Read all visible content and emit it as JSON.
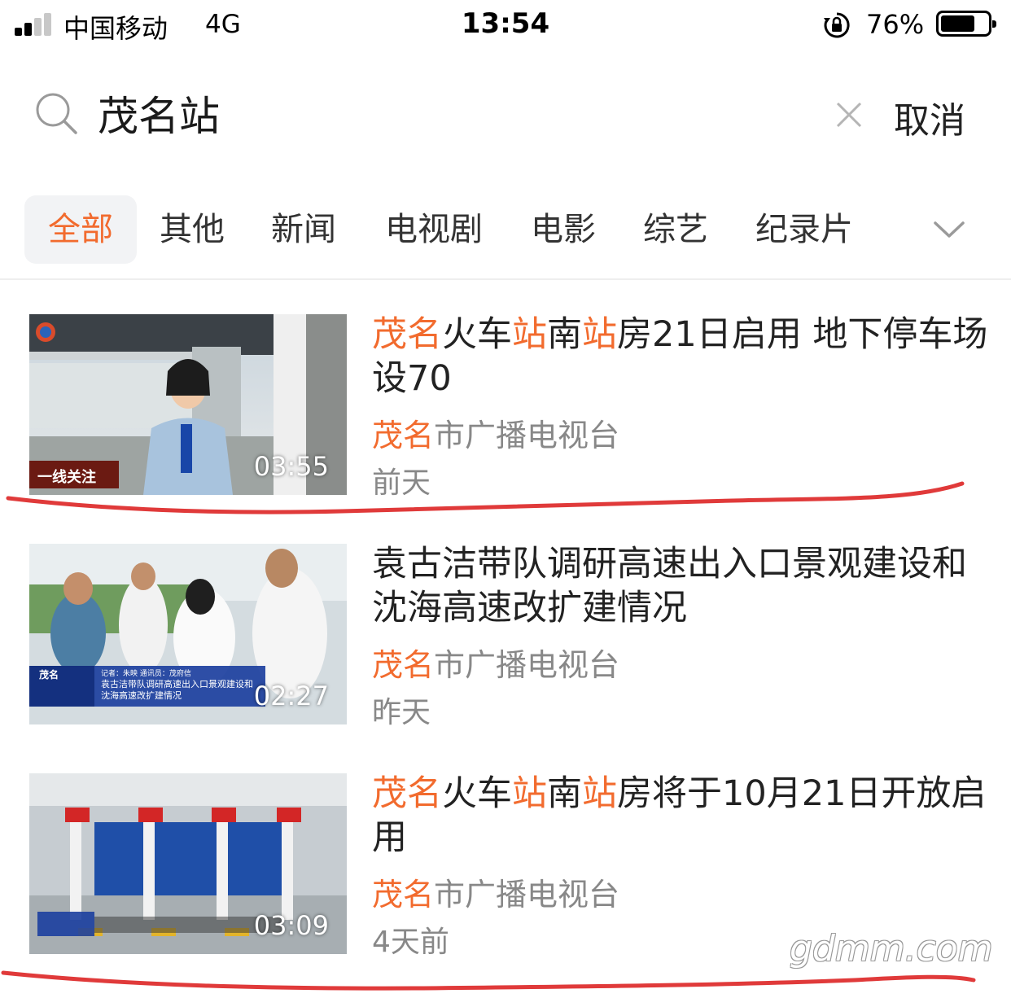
{
  "status_bar": {
    "carrier": "中国移动",
    "network": "4G",
    "time": "13:54",
    "battery_percent": "76%",
    "battery_level": 0.76
  },
  "search": {
    "query": "茂名站",
    "cancel_label": "取消"
  },
  "tabs": [
    {
      "label": "全部",
      "active": true
    },
    {
      "label": "其他",
      "active": false
    },
    {
      "label": "新闻",
      "active": false
    },
    {
      "label": "电视剧",
      "active": false
    },
    {
      "label": "电影",
      "active": false
    },
    {
      "label": "综艺",
      "active": false
    },
    {
      "label": "纪录片",
      "active": false
    }
  ],
  "highlight_color": "#f26b2e",
  "results": [
    {
      "title_segments": [
        {
          "text": "茂名",
          "hl": true
        },
        {
          "text": "火车",
          "hl": false
        },
        {
          "text": "站",
          "hl": true
        },
        {
          "text": "南",
          "hl": false
        },
        {
          "text": "站",
          "hl": true
        },
        {
          "text": "房21日启用 地下停车场设70",
          "hl": false
        }
      ],
      "source_segments": [
        {
          "text": "茂名",
          "hl": true
        },
        {
          "text": "市广播电视台",
          "hl": false
        }
      ],
      "date": "前天",
      "duration": "03:55"
    },
    {
      "title_segments": [
        {
          "text": "袁古洁带队调研高速出入口景观建设和沈海高速改扩建情况",
          "hl": false
        }
      ],
      "source_segments": [
        {
          "text": "茂名",
          "hl": true
        },
        {
          "text": "市广播电视台",
          "hl": false
        }
      ],
      "date": "昨天",
      "duration": "02:27"
    },
    {
      "title_segments": [
        {
          "text": "茂名",
          "hl": true
        },
        {
          "text": "火车",
          "hl": false
        },
        {
          "text": "站",
          "hl": true
        },
        {
          "text": "南",
          "hl": false
        },
        {
          "text": "站",
          "hl": true
        },
        {
          "text": "房将于10月21日开放启用",
          "hl": false
        }
      ],
      "source_segments": [
        {
          "text": "茂名",
          "hl": true
        },
        {
          "text": "市广播电视台",
          "hl": false
        }
      ],
      "date": "4天前",
      "duration": "03:09"
    }
  ],
  "thumbnail_overlays": {
    "first_banner": "一线关注",
    "second_lower_third": "袁古洁带队调研高速出入口景观建设和沈海高速改扩建情况",
    "second_reporter": "记者：朱映  通讯员：茂府信",
    "second_channel": "茂名"
  },
  "watermark": "gdmm.com"
}
